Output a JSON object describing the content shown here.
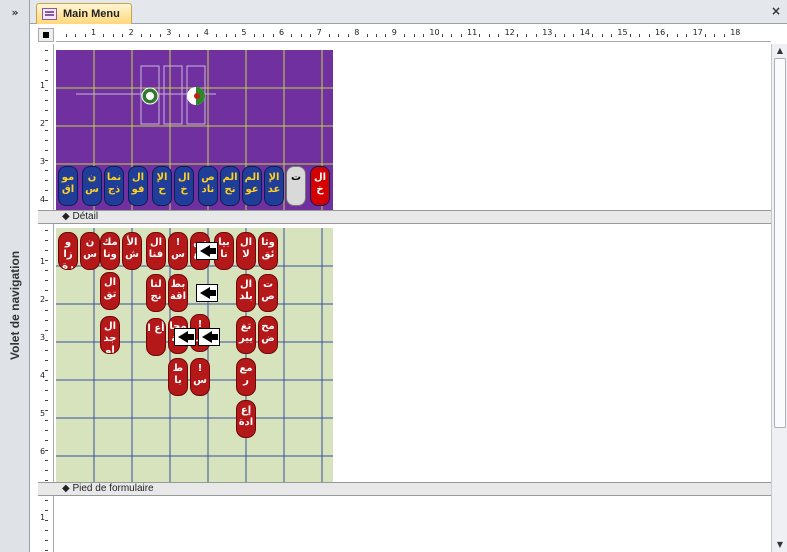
{
  "navigation_pane": {
    "toggle": "»",
    "label": "Volet de navigation"
  },
  "tab": {
    "title": "Main Menu",
    "close": "×"
  },
  "ruler": {
    "h_numbers": [
      "1",
      "2",
      "3",
      "4",
      "5",
      "6",
      "7",
      "8",
      "9",
      "10",
      "11",
      "12",
      "13",
      "14",
      "15",
      "16",
      "17",
      "18"
    ],
    "v_numbers": [
      "1",
      "2",
      "3",
      "4",
      "1",
      "2",
      "3",
      "4",
      "5",
      "6",
      "1"
    ]
  },
  "sections": {
    "detail": "Détail",
    "footer": "Pied de formulaire"
  },
  "header_buttons": [
    "مو اق",
    "ن س",
    "نما ذج",
    "ال فو",
    "الإ ح",
    "ال خ",
    "ص ناد",
    "الم نح",
    "الم عو",
    "الإ عد",
    "ت",
    "ال خ"
  ],
  "detail_buttons": [
    "و زا رة",
    "ن س",
    "مك ونا",
    "الأ ش",
    "ال فنا",
    "! س",
    "س مع",
    "بيا نا",
    "ال لا",
    "وثا ئق",
    "ال تق",
    "ال جد او",
    "لنا نج",
    "بط اقة",
    "ال بلد",
    "ت ص",
    "أع ا",
    "محا جة",
    "! س",
    "تغ يير",
    "مح ض",
    "ط با",
    "! س",
    "مع ر",
    "إع ادة"
  ],
  "scroll": {
    "up": "▲",
    "down": "▼"
  }
}
